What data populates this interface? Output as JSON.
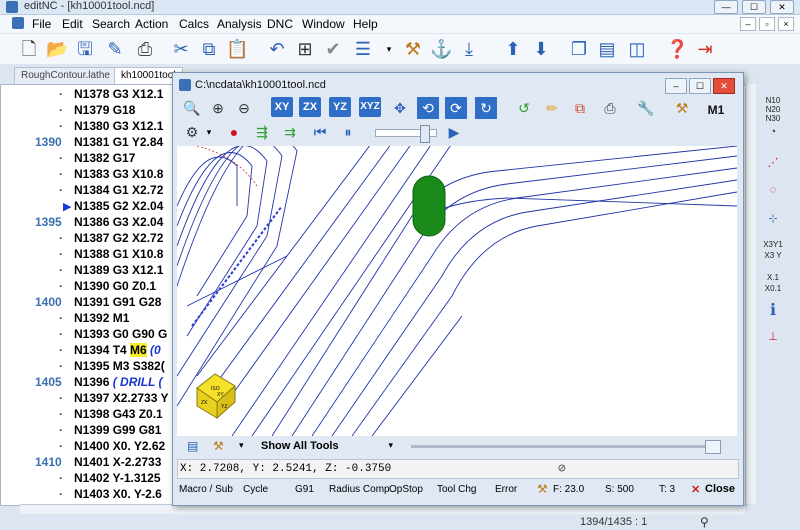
{
  "window": {
    "title": "editNC - [kh10001tool.ncd]",
    "minimize": "—",
    "maximize": "☐",
    "close": "✕"
  },
  "menu": [
    "File",
    "Edit",
    "Search",
    "Action",
    "Calcs",
    "Analysis",
    "DNC",
    "Window",
    "Help"
  ],
  "mdi_controls": [
    "–",
    "▫",
    "×"
  ],
  "toolbar": {
    "icons": [
      "new-icon",
      "open-icon",
      "save-icon",
      "edit-icon",
      "print-icon",
      "cut-icon",
      "copy-icon",
      "paste-icon",
      "undo-icon",
      "find-icon",
      "check-icon",
      "format-icon",
      "tool-icon",
      "anchor-icon",
      "drill-icon",
      "upload-icon",
      "download-icon",
      "windows-icon",
      "list-icon",
      "panel-icon",
      "help-icon",
      "exit-icon"
    ]
  },
  "tabs": [
    {
      "label": "RoughContour.lathe"
    },
    {
      "label": "kh10001tool"
    }
  ],
  "editor": {
    "lines": [
      {
        "num": "",
        "code": "N1378 G3 X12.1",
        "dot": true
      },
      {
        "num": "",
        "code": "N1379 G18",
        "dot": true
      },
      {
        "num": "",
        "code": "N1380 G3 X12.1",
        "dot": true
      },
      {
        "num": "1390",
        "code": "N1381 G1 Y2.84",
        "dot": false
      },
      {
        "num": "",
        "code": "N1382 G17",
        "dot": true
      },
      {
        "num": "",
        "code": "N1383 G3 X10.8",
        "dot": true
      },
      {
        "num": "",
        "code": "N1384 G1 X2.72",
        "dot": true
      },
      {
        "num": "",
        "code": "N1385 G2 X2.04",
        "dot": false,
        "marker": true
      },
      {
        "num": "1395",
        "code": "N1386 G3 X2.04",
        "dot": false
      },
      {
        "num": "",
        "code": "N1387 G2 X2.72",
        "dot": true
      },
      {
        "num": "",
        "code": "N1388 G1 X10.8",
        "dot": true
      },
      {
        "num": "",
        "code": "N1389 G3 X12.1",
        "dot": true
      },
      {
        "num": "",
        "code": "N1390 G0 Z0.1",
        "dot": true
      },
      {
        "num": "1400",
        "code": "N1391 G91 G28",
        "dot": false
      },
      {
        "num": "",
        "code": "N1392 M1",
        "dot": true
      },
      {
        "num": "",
        "code": "N1393 G0 G90 G",
        "dot": true
      },
      {
        "num": "",
        "code": "N1394 T4 ",
        "hl": "M6",
        "tail": " (0",
        "dot": true
      },
      {
        "num": "",
        "code": "N1395 M3 S382(",
        "dot": true
      },
      {
        "num": "1405",
        "code": "N1396 ",
        "comment": "( DRILL (",
        "dot": false
      },
      {
        "num": "",
        "code": "N1397 X2.2733 Y",
        "dot": true
      },
      {
        "num": "",
        "code": "N1398 G43 Z0.1",
        "dot": true
      },
      {
        "num": "",
        "code": "N1399 G99 G81",
        "dot": true
      },
      {
        "num": "",
        "code": "N1400 X0. Y2.62",
        "dot": true
      },
      {
        "num": "1410",
        "code": "N1401 X-2.2733",
        "dot": false
      },
      {
        "num": "",
        "code": "N1402 Y-1.3125",
        "dot": true
      },
      {
        "num": "",
        "code": "N1403 X0. Y-2.6",
        "dot": true
      }
    ]
  },
  "backplot": {
    "title": "C:\\ncdata\\kh10001tool.ncd",
    "view_buttons": [
      "XY",
      "ZX",
      "YZ",
      "XYZ"
    ],
    "tool_label": "M1",
    "tools_dropdown": "Show All Tools",
    "coords": "X: 2.7208, Y: 2.5241, Z: -0.3750",
    "cube_labels": [
      "ISO",
      "XY",
      "ZX",
      "YZ"
    ],
    "status_items": [
      "Macro / Sub",
      "Cycle",
      "G91",
      "Radius Comp",
      "OpStop",
      "Tool Chg",
      "Error"
    ],
    "feed": "F: 23.0",
    "speed": "S: 500",
    "tool": "T: 3",
    "close": "Close",
    "tool_color": "#1a8a1a"
  },
  "rightbar": [
    "N10 N20 N30",
    "gauge-icon",
    "path-icon",
    "arc-icon",
    "grid-icon",
    "X3Y1 X3 Y",
    "X.1 X0.1",
    "info-icon",
    "drill-icon"
  ],
  "statusbar": {
    "position": "1394/1435 : 1"
  }
}
